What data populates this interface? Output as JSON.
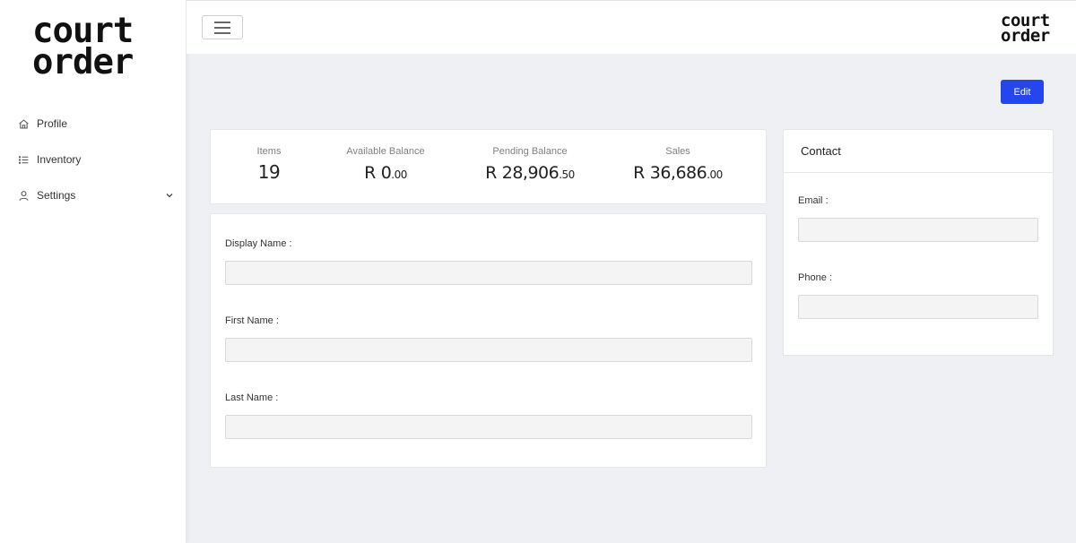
{
  "brand": {
    "logo_line1": "court",
    "logo_line2": "order"
  },
  "sidebar": {
    "items": [
      {
        "label": "Profile",
        "icon": "home-icon"
      },
      {
        "label": "Inventory",
        "icon": "list-icon"
      },
      {
        "label": "Settings",
        "icon": "user-icon",
        "expandable": true
      }
    ]
  },
  "toolbar": {
    "menu_icon": "hamburger-icon",
    "edit_label": "Edit"
  },
  "stats": [
    {
      "label": "Items",
      "value": "19"
    },
    {
      "label": "Available Balance",
      "currency": "R",
      "whole": "0",
      "cents": ".00"
    },
    {
      "label": "Pending Balance",
      "currency": "R",
      "whole": "28,906",
      "cents": ".50"
    },
    {
      "label": "Sales",
      "currency": "R",
      "whole": "36,686",
      "cents": ".00"
    }
  ],
  "profile": {
    "display_name_label": "Display Name",
    "display_name_value": "",
    "first_name_label": "First Name",
    "first_name_value": "",
    "last_name_label": "Last Name",
    "last_name_value": ""
  },
  "contact": {
    "title": "Contact",
    "email_label": "Email",
    "email_value": "",
    "phone_label": "Phone",
    "phone_value": ""
  },
  "colors": {
    "accent": "#2545ef",
    "background": "#eef0f4"
  }
}
